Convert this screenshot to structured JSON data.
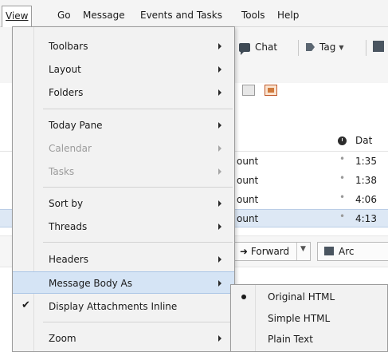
{
  "menubar": {
    "items": [
      {
        "label": "View"
      },
      {
        "label": "Go"
      },
      {
        "label": "Message"
      },
      {
        "label": "Events and Tasks"
      },
      {
        "label": "Tools"
      },
      {
        "label": "Help"
      }
    ]
  },
  "toolbar": {
    "chat_label": "Chat",
    "tag_label": "Tag"
  },
  "message_list": {
    "date_header": "Dat",
    "rows": [
      {
        "account": "ount",
        "date": "1:35"
      },
      {
        "account": "ount",
        "date": "1:38"
      },
      {
        "account": "ount",
        "date": "4:06"
      },
      {
        "account": "ount",
        "date": "4:13"
      }
    ]
  },
  "header_toolbar": {
    "forward_label": "Forward",
    "archive_label": "Arc"
  },
  "view_menu": {
    "items": [
      {
        "label": "Toolbars"
      },
      {
        "label": "Layout"
      },
      {
        "label": "Folders"
      },
      {
        "label": "Today Pane"
      },
      {
        "label": "Calendar"
      },
      {
        "label": "Tasks"
      },
      {
        "label": "Sort by"
      },
      {
        "label": "Threads"
      },
      {
        "label": "Headers"
      },
      {
        "label": "Message Body As"
      },
      {
        "label": "Display Attachments Inline"
      },
      {
        "label": "Zoom"
      }
    ],
    "check_glyph": "✔"
  },
  "body_as_submenu": {
    "items": [
      {
        "label": "Original HTML"
      },
      {
        "label": "Simple HTML"
      },
      {
        "label": "Plain Text"
      }
    ]
  }
}
